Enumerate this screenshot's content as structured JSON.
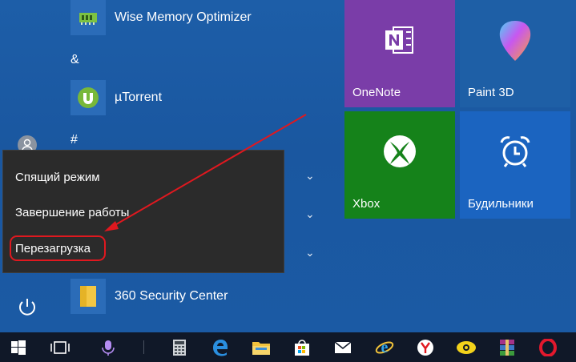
{
  "app_list": {
    "items": [
      {
        "label": "Wise Memory Optimizer",
        "icon": "wise-memory-icon"
      },
      {
        "label": "µTorrent",
        "icon": "utorrent-icon"
      },
      {
        "label": "360 Security Center",
        "icon": "folder-icon"
      }
    ],
    "letters": [
      "&",
      "#"
    ]
  },
  "power_menu": {
    "sleep": "Спящий режим",
    "shutdown": "Завершение работы",
    "restart": "Перезагрузка"
  },
  "tiles": [
    {
      "label": "OneNote",
      "color": "#7a3da8",
      "icon": "onenote-icon"
    },
    {
      "label": "Paint 3D",
      "color": "#1e5fa6",
      "icon": "paint3d-icon"
    },
    {
      "label": "Xbox",
      "color": "#15821a",
      "icon": "xbox-icon"
    },
    {
      "label": "Будильники",
      "color": "#1b64c0",
      "icon": "alarm-clock-icon"
    }
  ],
  "taskbar": {
    "icons": [
      "windows-start-icon",
      "task-view-icon",
      "cortana-icon",
      "calculator-icon",
      "edge-icon",
      "file-explorer-icon",
      "store-icon",
      "mail-icon",
      "internet-explorer-icon",
      "yandex-browser-icon",
      "winamp-icon",
      "winrar-icon",
      "opera-icon"
    ]
  },
  "colors": {
    "highlight": "#e0181f",
    "accent": "#1c5aa3"
  }
}
